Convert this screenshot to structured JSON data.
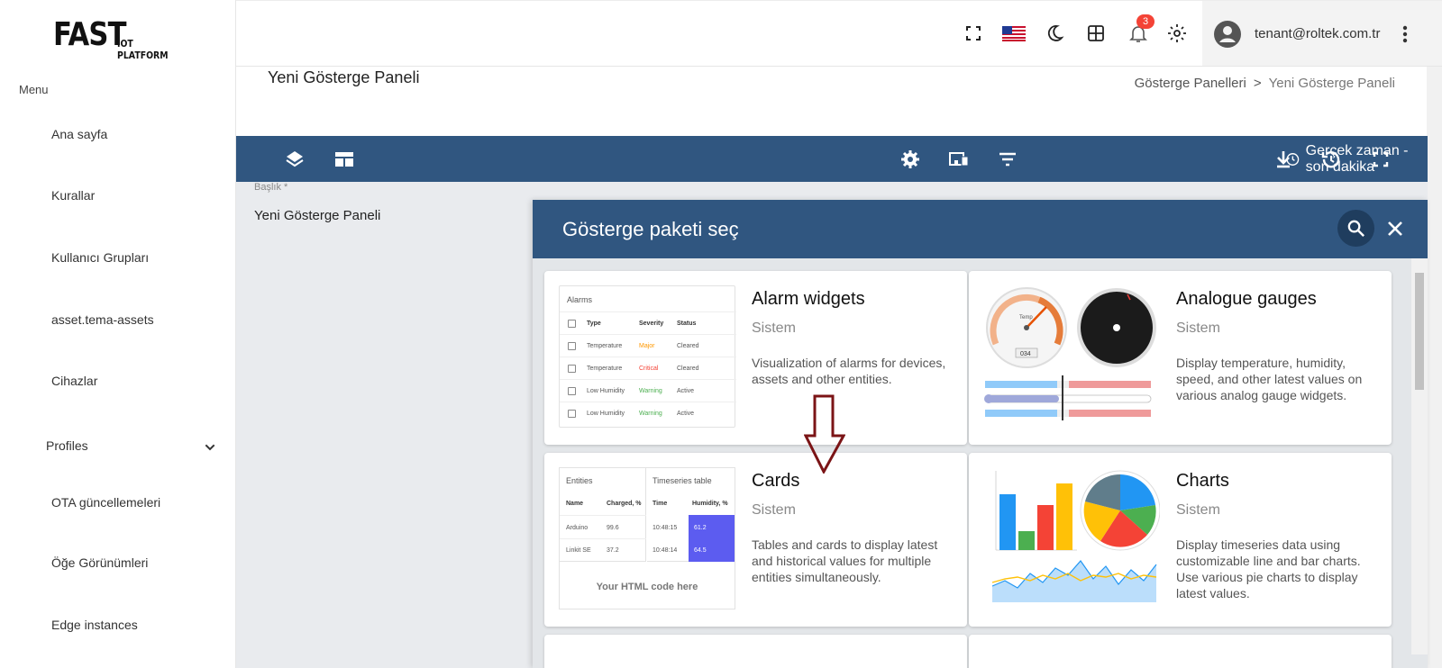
{
  "brand": {
    "logo_big": "FAST",
    "logo_small": "IOT PLATFORM"
  },
  "sidebar": {
    "heading": "Menu",
    "items": [
      {
        "label": "Ana sayfa"
      },
      {
        "label": "Kurallar"
      },
      {
        "label": "Kullanıcı Grupları"
      },
      {
        "label": "asset.tema-assets"
      },
      {
        "label": "Cihazlar"
      },
      {
        "label": "Profiles"
      },
      {
        "label": "OTA güncellemeleri"
      },
      {
        "label": "Öğe Görünümleri"
      },
      {
        "label": "Edge instances"
      }
    ]
  },
  "topbar": {
    "notification_count": "3",
    "user_email": "tenant@roltek.com.tr",
    "icons": [
      "fullscreen-icon",
      "us-flag-icon",
      "dark-mode-icon",
      "apps-grid-icon",
      "bell-icon",
      "settings-icon",
      "account-icon",
      "more-vert-icon"
    ]
  },
  "page": {
    "title": "Yeni Gösterge Paneli",
    "breadcrumb": [
      "Gösterge Panelleri",
      ">",
      "Yeni Gösterge Paneli"
    ]
  },
  "toolbar": {
    "realtime_label": "Gerçek zaman - son dakika"
  },
  "form": {
    "title_label": "Başlık *",
    "title_value": "Yeni Gösterge Paneli"
  },
  "dialog": {
    "title": "Gösterge paketi seç",
    "cards": [
      {
        "title": "Alarm widgets",
        "subtitle": "Sistem",
        "description": "Visualization of alarms for devices, assets and other entities.",
        "preview": {
          "header": "Alarms",
          "columns": [
            "Type",
            "Severity",
            "Status"
          ],
          "rows": [
            [
              "Temperature",
              "Major",
              "Cleared"
            ],
            [
              "Temperature",
              "Critical",
              "Cleared"
            ],
            [
              "Low Humidity",
              "Warning",
              "Active"
            ],
            [
              "Low Humidity",
              "Warning",
              "Active"
            ]
          ]
        }
      },
      {
        "title": "Analogue gauges",
        "subtitle": "Sistem",
        "description": "Display temperature, humidity, speed, and other latest values on various analog gauge widgets.",
        "preview": {
          "gauge_label": "Temp",
          "gauge_readout": "034"
        }
      },
      {
        "title": "Cards",
        "subtitle": "Sistem",
        "description": "Tables and cards to display latest and historical values for multiple entities simultaneously.",
        "preview": {
          "entities_header": "Entities",
          "entities_columns": [
            "Name",
            "Charged, %"
          ],
          "entities_rows": [
            [
              "Arduino",
              "99.6"
            ],
            [
              "Linkit SE",
              "37.2"
            ]
          ],
          "ts_header": "Timeseries table",
          "ts_columns": [
            "Time",
            "Humidity, %"
          ],
          "ts_rows": [
            [
              "10:48:15",
              "61.2"
            ],
            [
              "10:48:14",
              "64.5"
            ]
          ],
          "html_placeholder": "Your HTML code here"
        }
      },
      {
        "title": "Charts",
        "subtitle": "Sistem",
        "description": "Display timeseries data using customizable line and bar charts. Use various pie charts to display latest values.",
        "preview": {}
      }
    ]
  },
  "colors": {
    "primary": "#305680",
    "badge": "#f44336",
    "arrow": "#7b1416",
    "major": "#ff9800",
    "critical": "#f44336",
    "warning": "#4caf50"
  }
}
